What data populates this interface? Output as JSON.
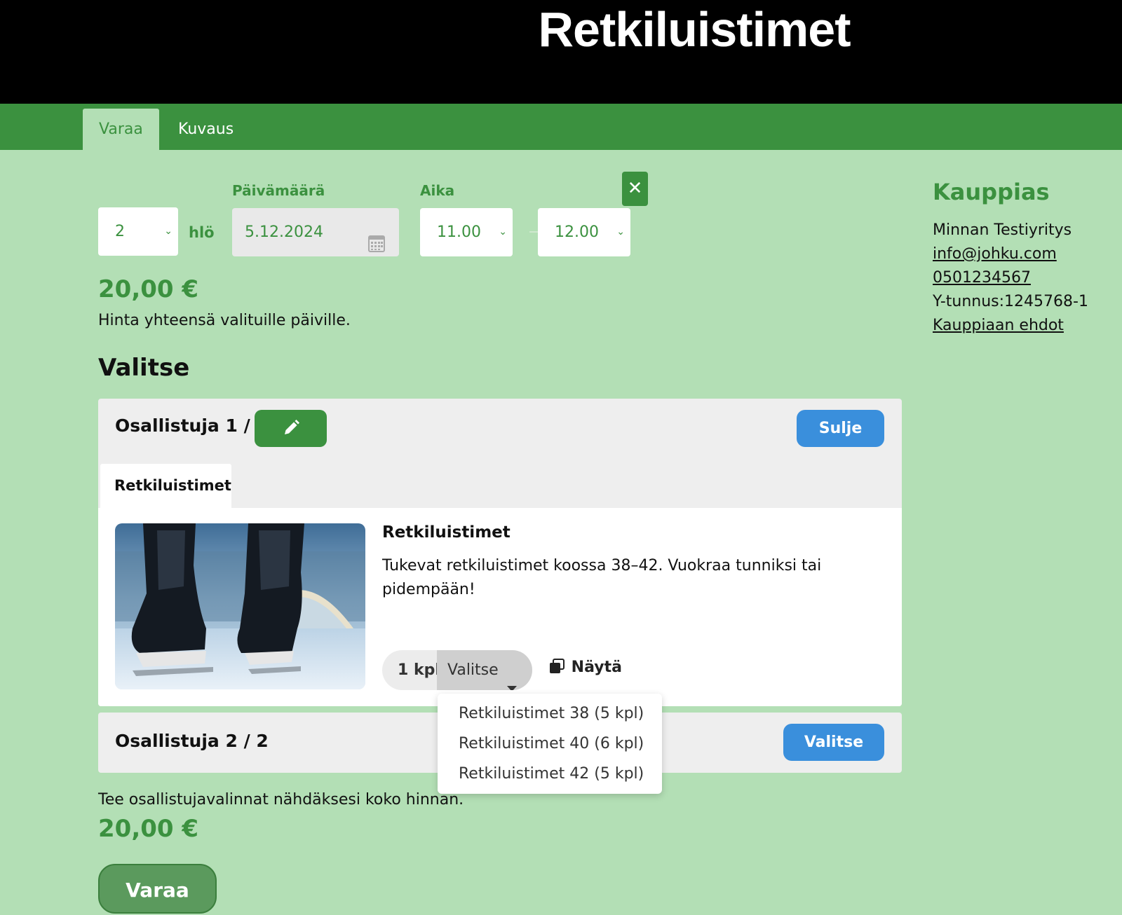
{
  "header": {
    "title": "Retkiluistimet"
  },
  "tabs": {
    "book": "Varaa",
    "description": "Kuvaus"
  },
  "form": {
    "persons_value": "2",
    "persons_unit": "hlö",
    "date_label": "Päivämäärä",
    "date_value": "5.12.2024",
    "time_label": "Aika",
    "start_time": "11.00",
    "end_time": "12.00"
  },
  "pricing": {
    "total": "20,00 €",
    "total_note": "Hinta yhteensä valituille päiville.",
    "bottom_note": "Tee osallistujavalinnat nähdäksesi koko hinnan.",
    "bottom_total": "20,00 €"
  },
  "select_section": {
    "title": "Valitse"
  },
  "participant1": {
    "title": "Osallistuja 1 / 2",
    "close_label": "Sulje",
    "tab_label": "Retkiluistimet",
    "product": {
      "name": "Retkiluistimet",
      "description": "Tukevat retkiluistimet koossa 38–42. Vuokraa tunniksi tai pidempään!",
      "quantity": "1 kpl",
      "choose_label": "Valitse",
      "show_label": "Näytä"
    },
    "dropdown_options": [
      "Retkiluistimet 38 (5 kpl)",
      "Retkiluistimet 40 (6 kpl)",
      "Retkiluistimet 42 (5 kpl)"
    ]
  },
  "participant2": {
    "title": "Osallistuja 2 / 2",
    "choose_label": "Valitse"
  },
  "book_button": "Varaa",
  "merchant": {
    "title": "Kauppias",
    "name": "Minnan Testiyritys",
    "email": "info@johku.com",
    "phone": "0501234567",
    "business_id": "Y-tunnus:1245768-1",
    "terms_link": "Kauppiaan ehdot"
  },
  "colors": {
    "green": "#3b913f",
    "background": "#b3dfb5",
    "blue": "#3a8fdc"
  }
}
